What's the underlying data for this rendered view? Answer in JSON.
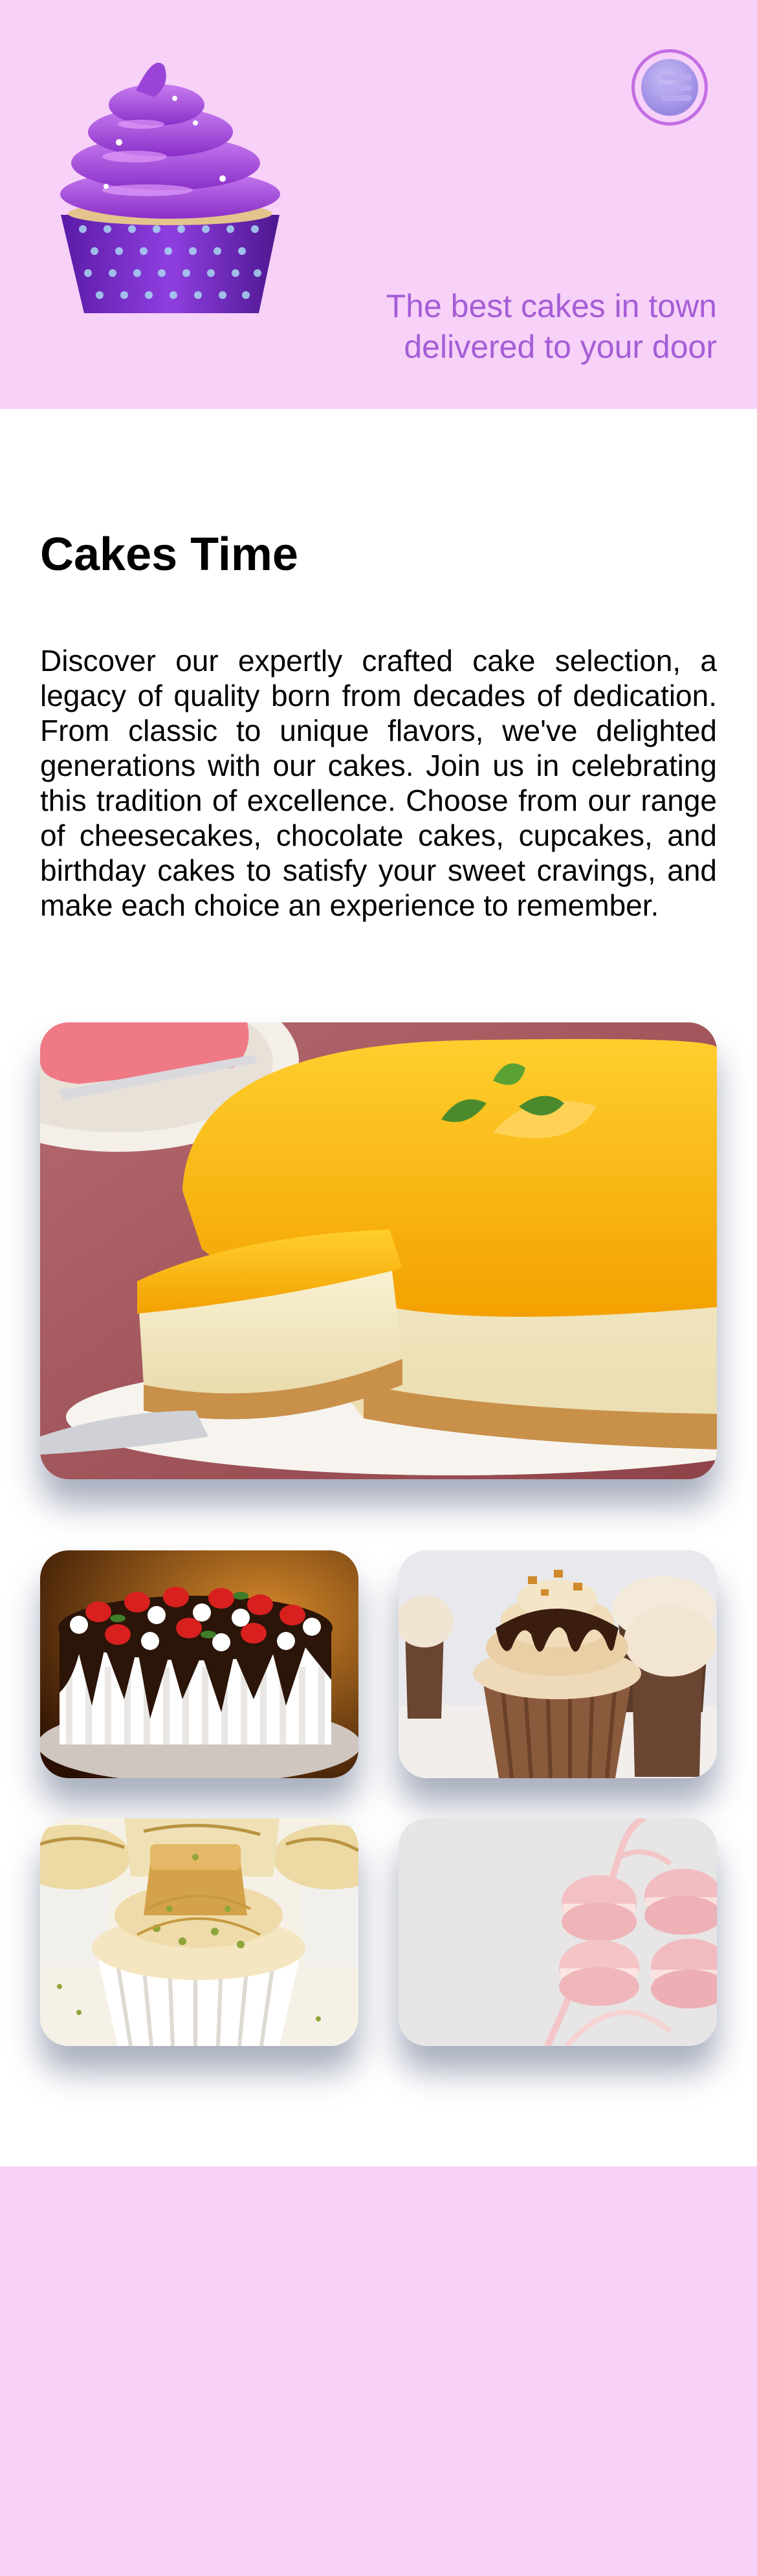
{
  "header": {
    "logo_icon": "cupcake-logo-icon",
    "menu_icon": "hamburger-menu-icon",
    "tagline": "The best cakes in town delivered to your door",
    "background_color": "#f7d1f7",
    "accent_color": "#a45dd6"
  },
  "main": {
    "title": "Cakes Time",
    "intro": "Discover our expertly crafted cake selection, a legacy of quality born from decades of dedication. From classic to unique flavors, we've delighted generations with our cakes. Join us in celebrating this tradition of excellence. Choose from our range of cheesecakes, chocolate cakes, cupcakes, and birthday cakes to satisfy your sweet cravings, and make each choice an experience to remember."
  },
  "gallery": {
    "hero": "mango-cheesecake-photo",
    "tiles": [
      "chocolate-strawberry-cake-photo",
      "caramel-cupcakes-photo",
      "pistachio-cupcake-photo",
      "pink-macarons-photo"
    ]
  },
  "footer": {
    "background_color": "#f7d1f7"
  }
}
